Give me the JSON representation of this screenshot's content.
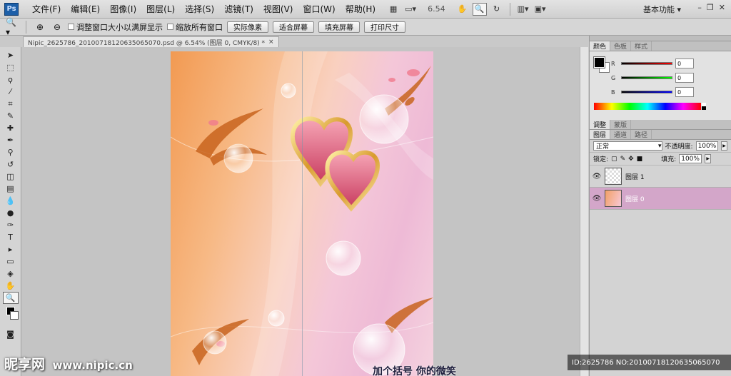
{
  "app": {
    "logo": "Ps",
    "workspace": "基本功能 ▾"
  },
  "menu": [
    "文件(F)",
    "编辑(E)",
    "图像(I)",
    "图层(L)",
    "选择(S)",
    "滤镜(T)",
    "视图(V)",
    "窗口(W)",
    "帮助(H)"
  ],
  "menubar_tools": {
    "zoom_level": "6.54"
  },
  "options_bar": {
    "checkbox_resize": "调整窗口大小以满屏显示",
    "checkbox_zoom_all": "缩放所有窗口",
    "buttons": [
      "实际像素",
      "适合屏幕",
      "填充屏幕",
      "打印尺寸"
    ]
  },
  "document": {
    "tab_title": "Nipic_2625786_20100718120635065070.psd @ 6.54% (图层 0, CMYK/8) *",
    "close": "×"
  },
  "color_panel": {
    "tabs": [
      "颜色",
      "色板",
      "样式"
    ],
    "channels": [
      {
        "name": "R",
        "value": "0",
        "color": "#d82020"
      },
      {
        "name": "G",
        "value": "0",
        "color": "#10a010"
      },
      {
        "name": "B",
        "value": "0",
        "color": "#1830c8"
      }
    ]
  },
  "adjust_tabs": [
    "调整",
    "蒙版"
  ],
  "layers_panel": {
    "tabs": [
      "图层",
      "通道",
      "路径"
    ],
    "blend_mode": "正常",
    "opacity_label": "不透明度:",
    "opacity": "100%",
    "lock_label": "锁定:",
    "fill_label": "填充:",
    "fill": "100%",
    "layers": [
      {
        "name": "图层 1",
        "selected": false
      },
      {
        "name": "图层 0",
        "selected": true
      }
    ]
  },
  "watermark": {
    "logo": "昵享网",
    "url": "www.nipic.cn",
    "id_text": "ID:2625786 NO:20100718120635065070",
    "caption": "加个括号  你的微笑"
  },
  "colors": {
    "accent_selected_layer": "#d3a6c9"
  }
}
